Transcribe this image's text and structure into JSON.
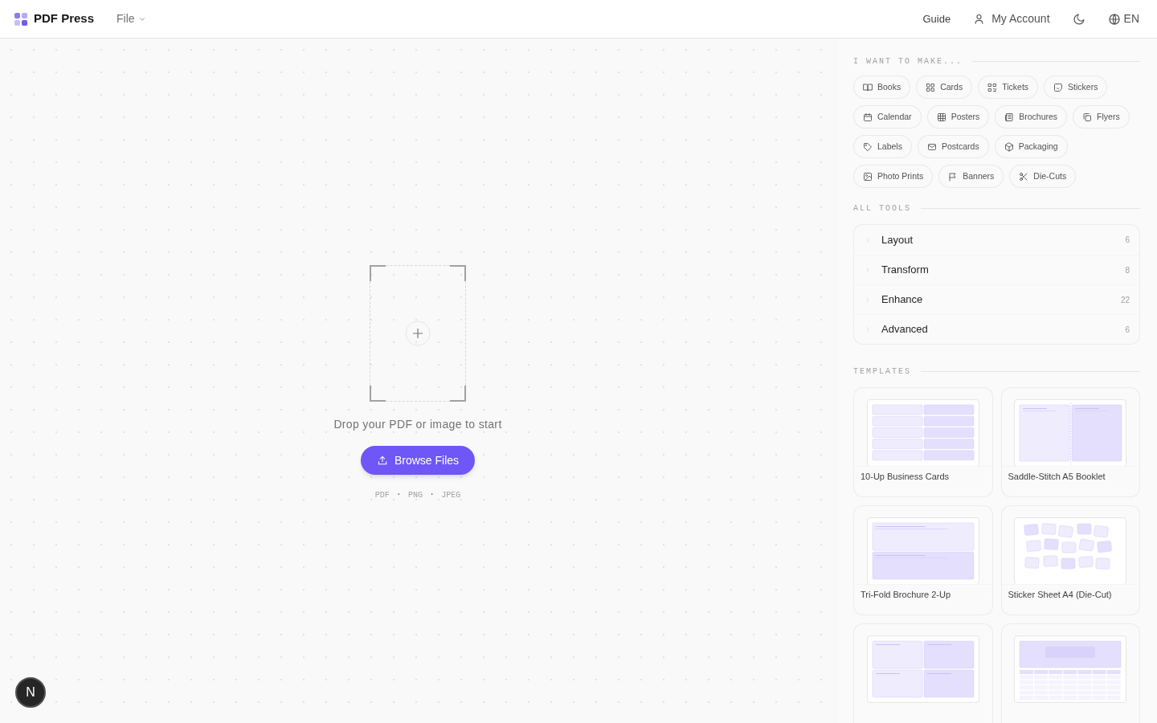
{
  "header": {
    "brand": "PDF Press",
    "menu": "File",
    "links": [
      {
        "kind": "text",
        "label": "Guide"
      },
      {
        "kind": "account",
        "label": "My Account"
      },
      {
        "kind": "theme"
      },
      {
        "kind": "language",
        "label": "EN"
      }
    ]
  },
  "dropzone": {
    "prompt": "Drop your PDF or image to start",
    "button": "Browse Files",
    "formats": [
      "PDF",
      "PNG",
      "JPEG"
    ],
    "separator": "·"
  },
  "floating_button": "N",
  "make": {
    "heading": "I WANT TO MAKE...",
    "items": [
      {
        "label": "Books"
      },
      {
        "label": "Cards"
      },
      {
        "label": "Tickets"
      },
      {
        "label": "Stickers"
      },
      {
        "label": "Calendar"
      },
      {
        "label": "Posters"
      },
      {
        "label": "Brochures"
      },
      {
        "label": "Flyers"
      },
      {
        "label": "Labels"
      },
      {
        "label": "Postcards"
      },
      {
        "label": "Packaging"
      },
      {
        "label": "Photo Prints"
      },
      {
        "label": "Banners"
      },
      {
        "label": "Die-Cuts"
      }
    ]
  },
  "tools": {
    "heading": "ALL TOOLS",
    "groups": [
      {
        "label": "Layout",
        "count": "6",
        "expanded": false
      },
      {
        "label": "Transform",
        "count": "8",
        "expanded": false
      },
      {
        "label": "Enhance",
        "count": "22",
        "expanded": false
      },
      {
        "label": "Advanced",
        "count": "6",
        "expanded": false
      }
    ]
  },
  "templates": {
    "heading": "TEMPLATES",
    "items": [
      {
        "kind": "cards",
        "name": "10-Up Business Cards"
      },
      {
        "kind": "booklet",
        "name": "Saddle-Stitch A5 Booklet"
      },
      {
        "kind": "trifold",
        "name": "Tri-Fold Brochure 2-Up"
      },
      {
        "kind": "stickers",
        "name": "Sticker Sheet A4 (Die-Cut)"
      },
      {
        "kind": "quad"
      },
      {
        "kind": "calendar"
      }
    ]
  }
}
